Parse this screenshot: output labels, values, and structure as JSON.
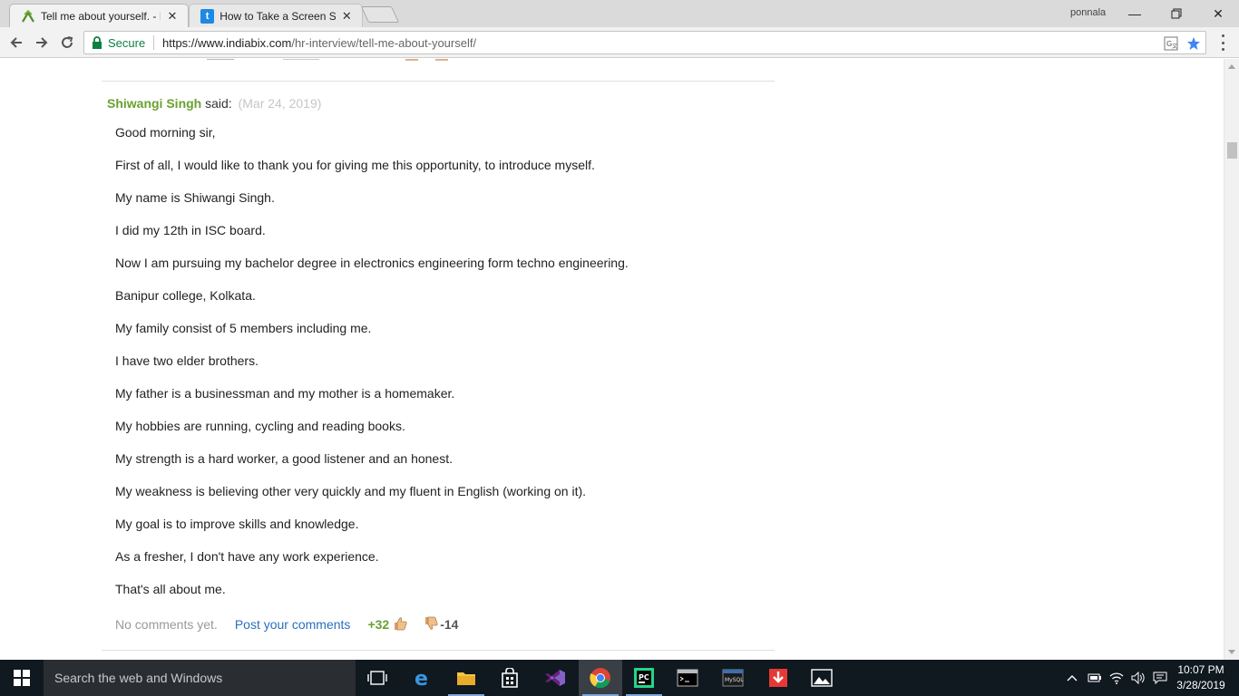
{
  "browser": {
    "tabs": [
      {
        "title": "Tell me about yourself. - I",
        "favicon": "indiabix-favicon",
        "active": true
      },
      {
        "title": "How to Take a Screen Sho",
        "favicon": "t-favicon",
        "active": false
      }
    ],
    "user": "ponnala",
    "secure_label": "Secure",
    "url_domain": "https://www.indiabix.com",
    "url_path": "/hr-interview/tell-me-about-yourself/"
  },
  "comment": {
    "author": "Shiwangi Singh",
    "said": "said:",
    "date": "(Mar 24, 2019)",
    "paragraphs": [
      "Good morning sir,",
      "First of all, I would like to thank you for giving me this opportunity, to introduce myself.",
      "My name is Shiwangi Singh.",
      "I did my 12th in ISC board.",
      "Now I am pursuing my bachelor degree in electronics engineering form techno engineering.",
      "Banipur college, Kolkata.",
      "My family consist of 5 members including me.",
      "I have two elder brothers.",
      "My father is a businessman and my mother is a homemaker.",
      "My hobbies are running, cycling and reading books.",
      "My strength is a hard worker, a good listener and an honest.",
      "My weakness is believing other very quickly and my fluent in English (working on it).",
      "My goal is to improve skills and knowledge.",
      "As a fresher, I don't have any work experience.",
      "That's all about me."
    ],
    "no_comments": "No comments yet.",
    "post_comments": "Post your comments",
    "upvotes": "+32",
    "downvotes": "-14"
  },
  "taskbar": {
    "search_placeholder": "Search the web and Windows",
    "time": "10:07 PM",
    "date": "3/28/2019",
    "apps": [
      "task-view-icon",
      "edge-icon",
      "file-explorer-icon",
      "store-icon",
      "visual-studio-icon",
      "chrome-icon",
      "pycharm-icon",
      "terminal-icon",
      "mysql-icon",
      "download-icon",
      "photos-icon"
    ]
  },
  "colors": {
    "author_green": "#6aa130",
    "link_blue": "#2a6fbf",
    "secure_green": "#0b8043",
    "taskbar": "#101820"
  }
}
